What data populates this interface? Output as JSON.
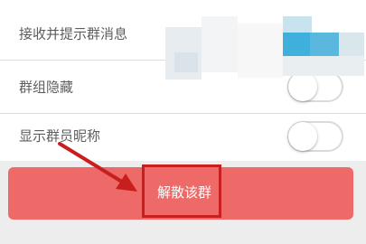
{
  "settings": [
    {
      "label": "接收并提示群消息",
      "enabled": true
    },
    {
      "label": "群组隐藏",
      "enabled": false
    },
    {
      "label": "显示群员昵称",
      "enabled": false
    }
  ],
  "disband_button": {
    "label": "解散该群"
  },
  "colors": {
    "toggle_on": "#3fb0dc",
    "danger_button": "#ee6a69",
    "annotation": "#c81e1e"
  },
  "icons": {
    "annotation_arrow": "arrow-right-down-icon"
  }
}
